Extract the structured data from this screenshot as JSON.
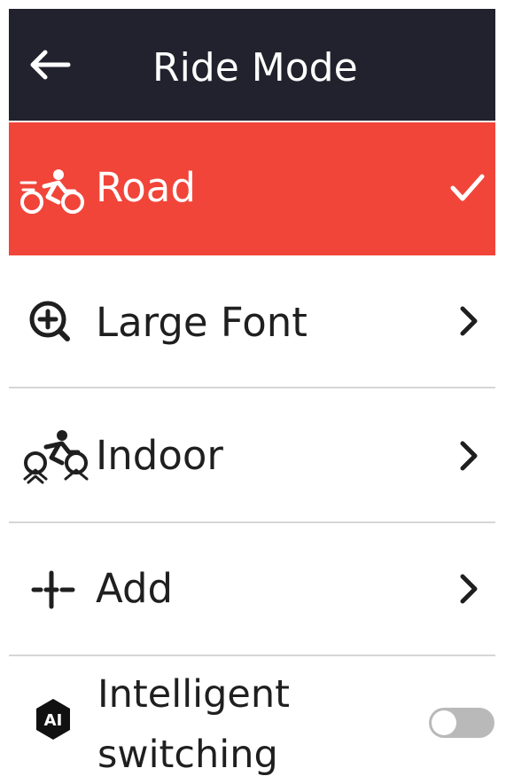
{
  "header": {
    "title": "Ride Mode",
    "back_icon": "arrow-left-icon"
  },
  "modes": [
    {
      "label": "Road",
      "icon": "road-bike-icon",
      "selected": true,
      "trailing": "checkmark-icon"
    },
    {
      "label": "Large Font",
      "icon": "zoom-in-icon",
      "selected": false,
      "trailing": "chevron-right-icon"
    },
    {
      "label": "Indoor",
      "icon": "indoor-bike-icon",
      "selected": false,
      "trailing": "chevron-right-icon"
    },
    {
      "label": "Add",
      "icon": "plus-icon",
      "selected": false,
      "trailing": "chevron-right-icon"
    }
  ],
  "intelligent": {
    "line1": "Intelligent",
    "line2": "switching",
    "icon": "ai-badge-icon",
    "icon_text": "AI",
    "enabled": false
  },
  "colors": {
    "header_bg": "#22222e",
    "accent": "#f1453a",
    "toggle_off": "#b9b9b9"
  }
}
